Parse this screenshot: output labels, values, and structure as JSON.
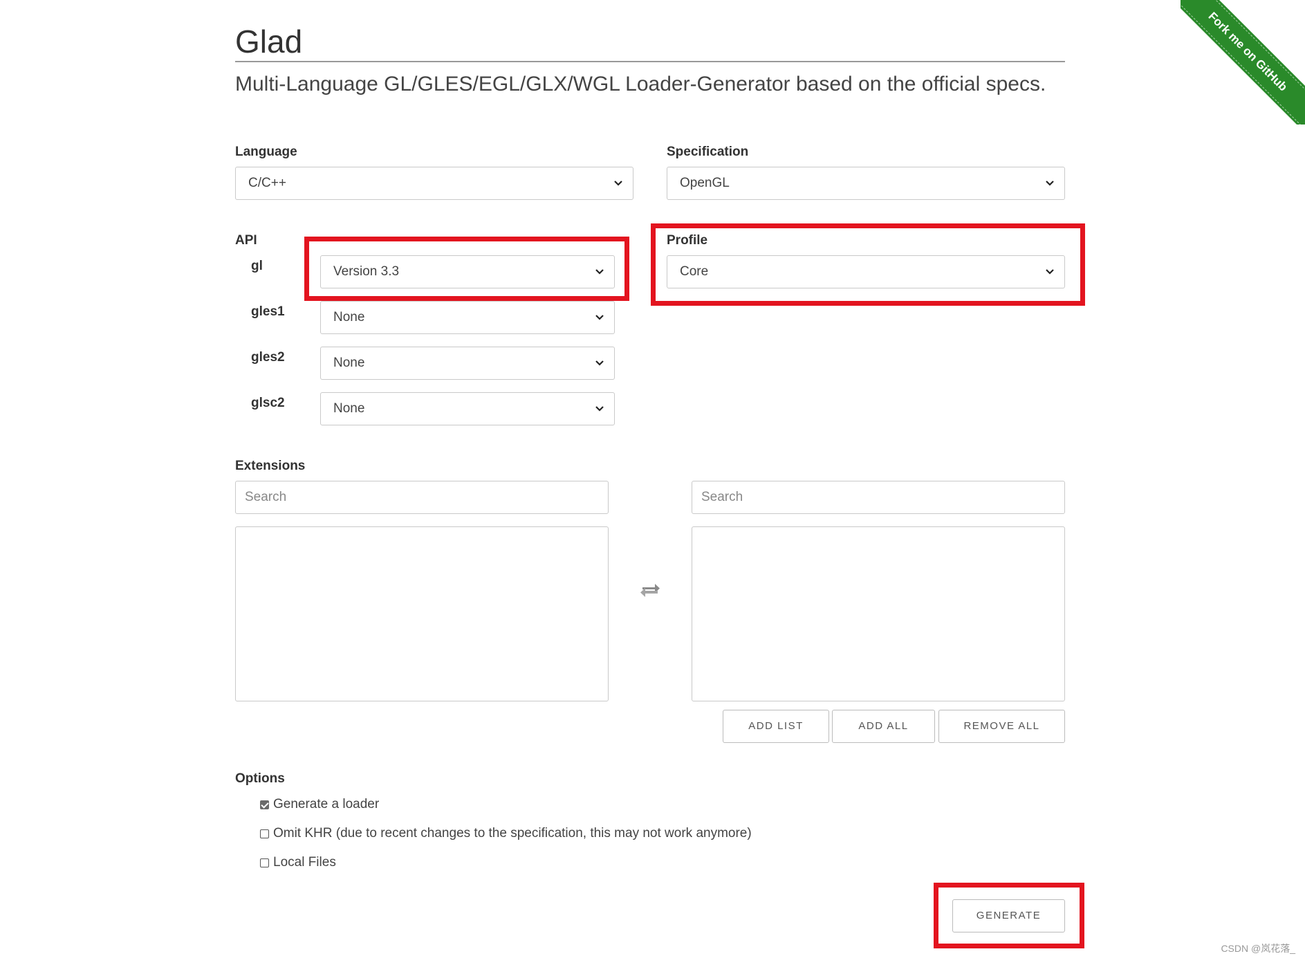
{
  "header": {
    "title": "Glad",
    "subtitle": "Multi-Language GL/GLES/EGL/GLX/WGL Loader-Generator based on the official specs."
  },
  "ribbon": {
    "text": "Fork me on GitHub",
    "color": "#2a8a2a"
  },
  "language": {
    "label": "Language",
    "value": "C/C++"
  },
  "specification": {
    "label": "Specification",
    "value": "OpenGL"
  },
  "api": {
    "label": "API",
    "rows": [
      {
        "name": "gl",
        "value": "Version 3.3"
      },
      {
        "name": "gles1",
        "value": "None"
      },
      {
        "name": "gles2",
        "value": "None"
      },
      {
        "name": "glsc2",
        "value": "None"
      }
    ]
  },
  "profile": {
    "label": "Profile",
    "value": "Core"
  },
  "extensions": {
    "label": "Extensions",
    "left_search_placeholder": "Search",
    "right_search_placeholder": "Search",
    "swap_icon": "swap-arrows-icon",
    "buttons": {
      "add_list": "ADD LIST",
      "add_all": "ADD ALL",
      "remove_all": "REMOVE ALL"
    }
  },
  "options": {
    "label": "Options",
    "items": [
      {
        "label": "Generate a loader",
        "checked": true
      },
      {
        "label": "Omit KHR (due to recent changes to the specification, this may not work anymore)",
        "checked": false
      },
      {
        "label": "Local Files",
        "checked": false
      }
    ]
  },
  "generate": {
    "label": "GENERATE"
  },
  "highlight_color": "#e3141f",
  "watermark": "CSDN @岚花落_"
}
